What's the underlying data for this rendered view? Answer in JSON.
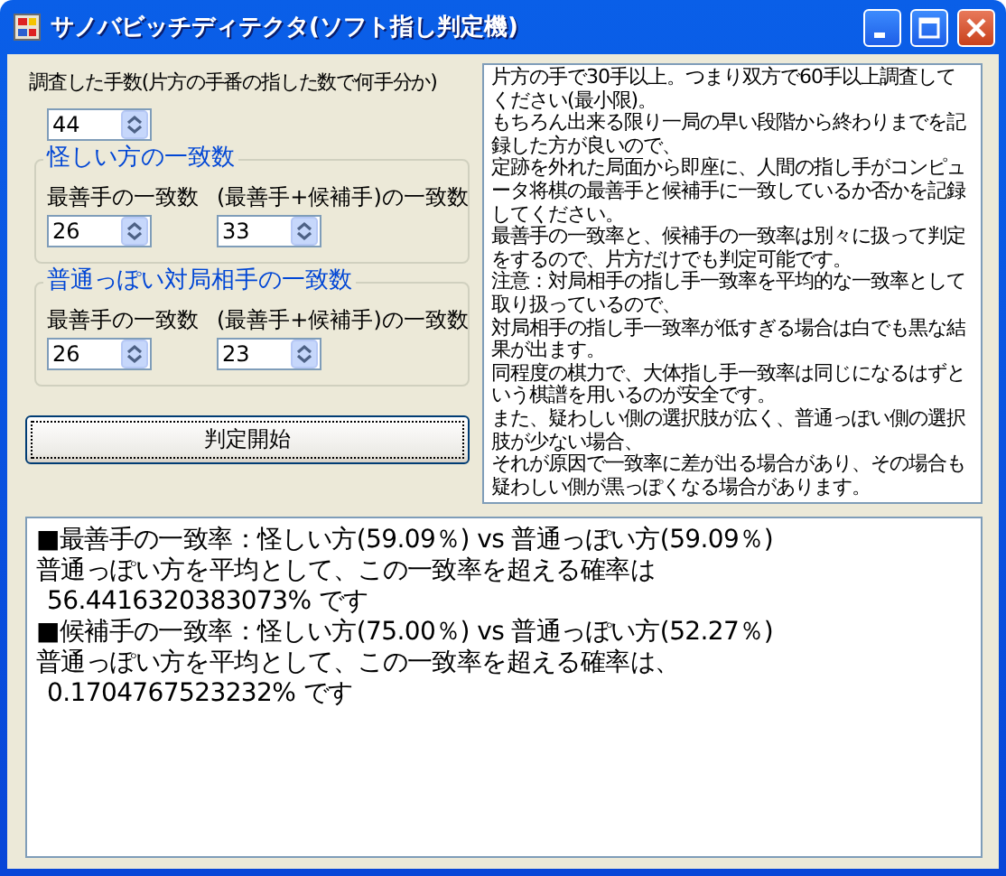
{
  "window": {
    "title": "サノバビッチディテクタ(ソフト指し判定機)"
  },
  "moves_label": "調査した手数(片方の手番の指した数で何手分か)",
  "moves_count": {
    "value": "44"
  },
  "groups": [
    {
      "title": "怪しい方の一致数",
      "fields": [
        {
          "label": "最善手の一致数",
          "value": "26"
        },
        {
          "label": "(最善手+候補手)の一致数",
          "value": "33"
        }
      ]
    },
    {
      "title": "普通っぽい対局相手の一致数",
      "fields": [
        {
          "label": "最善手の一致数",
          "value": "26"
        },
        {
          "label": "(最善手+候補手)の一致数",
          "value": "23"
        }
      ]
    }
  ],
  "judge_button": "判定開始",
  "instructions": [
    "片方の手で30手以上。つまり双方で60手以上調査してください(最小限)。",
    "もちろん出来る限り一局の早い段階から終わりまでを記録した方が良いので、",
    "定跡を外れた局面から即座に、人間の指し手がコンピュータ将棋の最善手と候補手に一致しているか否かを記録してください。",
    "最善手の一致率と、候補手の一致率は別々に扱って判定をするので、片方だけでも判定可能です。",
    "注意：対局相手の指し手一致率を平均的な一致率として取り扱っているので、",
    "対局相手の指し手一致率が低すぎる場合は白でも黒な結果が出ます。",
    "同程度の棋力で、大体指し手一致率は同じになるはずという棋譜を用いるのが安全です。",
    "また、疑わしい側の選択肢が広く、普通っぽい側の選択肢が少ない場合、",
    "それが原因で一致率に差が出る場合があり、その場合も疑わしい側が黒っぽくなる場合があります。"
  ],
  "results": [
    "■最善手の一致率：怪しい方(59.09％) vs 普通っぽい方(59.09％)",
    "普通っぽい方を平均として、この一致率を超える確率は",
    "56.4416320383073% です",
    "■候補手の一致率：怪しい方(75.00％) vs 普通っぽい方(52.27％)",
    "普通っぽい方を平均として、この一致率を超える確率は、",
    "0.1704767523232% です"
  ]
}
